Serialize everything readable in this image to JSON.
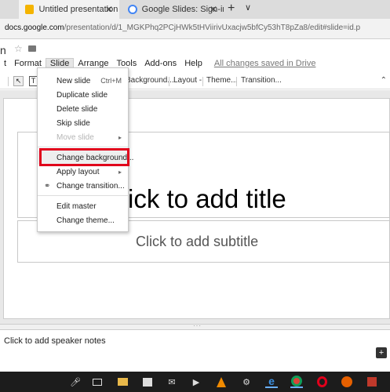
{
  "browser": {
    "tabs": [
      {
        "label": "Untitled presentation - ",
        "active": true,
        "favicon_color": "#f4b400"
      },
      {
        "label": "Google Slides: Sign-in",
        "active": false,
        "favicon_color": "#4285f4"
      }
    ],
    "tab_close": "✕",
    "new_tab": "+",
    "tab_menu": "∨",
    "address": {
      "domain": "docs.google.com",
      "path": "/presentation/d/1_MGKPhq2PCjHWk5tHViirivUxacjw5bfCy53hT8pZa8/edit#slide=id.p"
    }
  },
  "doc": {
    "title_fragment": "n",
    "star": "☆",
    "menus": [
      "t",
      "Format",
      "Slide",
      "Arrange",
      "Tools",
      "Add-ons",
      "Help"
    ],
    "saved_status": "All changes saved in Drive"
  },
  "toolbar": {
    "background_label": "Background...",
    "layout_label": "Layout -",
    "theme_label": "Theme...",
    "transition_label": "Transition...",
    "cursor_glyph": "↖",
    "textbox_glyph": "T",
    "collapse_glyph": "⌃"
  },
  "slide_menu": {
    "items": [
      {
        "label": "New slide",
        "shortcut": "Ctrl+M",
        "disabled": false
      },
      {
        "label": "Duplicate slide",
        "disabled": false
      },
      {
        "label": "Delete slide",
        "disabled": false
      },
      {
        "label": "Skip slide",
        "disabled": false
      },
      {
        "label": "Move slide",
        "disabled": true,
        "submenu": true
      },
      {
        "label": "Change background...",
        "disabled": false,
        "highlighted": true
      },
      {
        "label": "Apply layout",
        "disabled": false,
        "submenu": true
      },
      {
        "label": "Change transition...",
        "disabled": false,
        "icon": "link-icon"
      },
      {
        "label": "Edit master",
        "disabled": false
      },
      {
        "label": "Change theme...",
        "disabled": false
      }
    ],
    "submenu_arrow": "▸",
    "link_glyph": "⚭",
    "highlight_color": "#e0001b"
  },
  "slide": {
    "title_text": "ick to add title",
    "subtitle_text": "Click to add subtitle"
  },
  "notes": {
    "placeholder": "Click to add speaker notes",
    "add_glyph": "+"
  },
  "taskbar": {
    "icons": [
      "mic-icon",
      "task-view-icon",
      "file-explorer-icon",
      "store-icon",
      "mail-icon",
      "media-icon",
      "vlc-icon",
      "game-icon",
      "edge-icon",
      "chrome-icon",
      "opera-icon",
      "firefox-icon",
      "app-icon"
    ]
  }
}
